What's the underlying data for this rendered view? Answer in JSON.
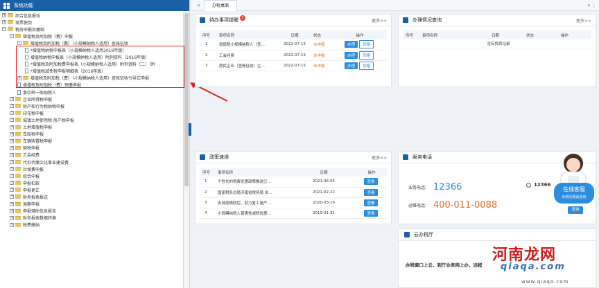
{
  "sidebar": {
    "title": "系统功能",
    "items": [
      {
        "t": "综合信息报告",
        "lvl": 0,
        "tog": "+",
        "ic": "fd"
      },
      {
        "t": "发票使用",
        "lvl": 0,
        "tog": "+",
        "ic": "fd"
      },
      {
        "t": "税务申报及缴纳",
        "lvl": 0,
        "tog": "-",
        "ic": "fd"
      },
      {
        "t": "增值税及附加税（费）申报",
        "lvl": 1,
        "tog": "-",
        "ic": "fd"
      },
      {
        "t": "增值税及附加税（费）（小规模纳税人适用）查账征收",
        "lvl": 2,
        "tog": "-",
        "ic": "fd"
      },
      {
        "t": "*增值税纳税申报表（小规模纳税人适用2016年版）",
        "lvl": 3,
        "tog": "",
        "ic": "doc"
      },
      {
        "t": "增值税纳税申报表（小规模纳税人适用）附列资料（2016年版）",
        "lvl": 3,
        "tog": "",
        "ic": "doc"
      },
      {
        "t": "*增值税及附加税费申报表（小规模纳税人适用）附列资料（二）（附",
        "lvl": 3,
        "tog": "",
        "ic": "doc"
      },
      {
        "t": "*增值税减免税申报明细表（2016年版）",
        "lvl": 3,
        "tog": "",
        "ic": "doc"
      },
      {
        "t": "增值税及附加税（费）（小规模纳税人适用）查账征收引导式申报",
        "lvl": 2,
        "tog": "+",
        "ic": "fd"
      },
      {
        "t": "增值税及附加税（费）预缴申报",
        "lvl": 2,
        "tog": "",
        "ic": "doc"
      },
      {
        "t": "事中转一般纳税人",
        "lvl": 2,
        "tog": "",
        "ic": "doc"
      },
      {
        "t": "企业所得税申报",
        "lvl": 1,
        "tog": "+",
        "ic": "fd"
      },
      {
        "t": "财产和行为税纳税申报",
        "lvl": 1,
        "tog": "+",
        "ic": "fd"
      },
      {
        "t": "印花税申报",
        "lvl": 1,
        "tog": "+",
        "ic": "fd"
      },
      {
        "t": "城镇土地使用税 房产税申报",
        "lvl": 1,
        "tog": "+",
        "ic": "fd"
      },
      {
        "t": "土地增值税申报",
        "lvl": 1,
        "tog": "+",
        "ic": "fd"
      },
      {
        "t": "车船税申报",
        "lvl": 1,
        "tog": "+",
        "ic": "fd"
      },
      {
        "t": "车辆购置税申报",
        "lvl": 1,
        "tog": "+",
        "ic": "fd"
      },
      {
        "t": "契税申报",
        "lvl": 1,
        "tog": "+",
        "ic": "fd"
      },
      {
        "t": "工会经费",
        "lvl": 1,
        "tog": "+",
        "ic": "fd"
      },
      {
        "t": "代扣代缴文化事业建设费",
        "lvl": 1,
        "tog": "+",
        "ic": "fd"
      },
      {
        "t": "社保费申报",
        "lvl": 1,
        "tog": "+",
        "ic": "fd"
      },
      {
        "t": "综合申报",
        "lvl": 1,
        "tog": "+",
        "ic": "fd"
      },
      {
        "t": "申报扣款",
        "lvl": 1,
        "tog": "+",
        "ic": "fd"
      },
      {
        "t": "申报更正",
        "lvl": 1,
        "tog": "+",
        "ic": "fd"
      },
      {
        "t": "财务报表报送",
        "lvl": 1,
        "tog": "+",
        "ic": "fd"
      },
      {
        "t": "逾期申报",
        "lvl": 1,
        "tog": "+",
        "ic": "fd"
      },
      {
        "t": "申报辅助信息报告",
        "lvl": 1,
        "tog": "+",
        "ic": "fd"
      },
      {
        "t": "财务报表数据转换",
        "lvl": 1,
        "tog": "+",
        "ic": "fd"
      },
      {
        "t": "税费缴纳",
        "lvl": 1,
        "tog": "+",
        "ic": "fd"
      }
    ]
  },
  "tabs": {
    "prev": "«",
    "current": "办税桌面",
    "next": "»",
    "menu": "⋮"
  },
  "todo": {
    "title": "待办事项提醒",
    "badge": "3",
    "more": "更多>>",
    "headers": [
      "序号",
      "事项名称",
      "日期",
      "状态",
      "操作"
    ],
    "rows": [
      {
        "no": "1",
        "name": "增值税小规模纳税人（查…",
        "date": "2022-07-15",
        "status": "未申报",
        "a": "办理",
        "b": "忽略"
      },
      {
        "no": "2",
        "name": "工会经费",
        "date": "2022-07-15",
        "status": "未申报",
        "a": "办理",
        "b": "忽略"
      },
      {
        "no": "3",
        "name": "房民企业（查账征收）企…",
        "date": "2022-07-15",
        "status": "未申报",
        "a": "办理",
        "b": "忽略"
      }
    ]
  },
  "handling": {
    "title": "办理情况查询",
    "more": "更多>>",
    "headers": [
      "序号",
      "事项名称",
      "日期",
      "状态",
      "操作"
    ],
    "empty": "没有找到记录"
  },
  "policy": {
    "title": "政策速递",
    "more": "更多>>",
    "headers": [
      "序号",
      "事项名称",
      "日期",
      "操作"
    ],
    "rows": [
      {
        "no": "1",
        "name": "个性化的税费优惠政策推送已…",
        "date": "2021-08-05",
        "a": "查看"
      },
      {
        "no": "2",
        "name": "国家税务总局河南省税务局 关…",
        "date": "2021-02-22",
        "a": "查看"
      },
      {
        "no": "3",
        "name": "支持疫情防控、助力复工复产…",
        "date": "2020-03-16",
        "a": "查看"
      },
      {
        "no": "4",
        "name": "小规模纳税人普惠性减税优惠…",
        "date": "2019-01-31",
        "a": "查看"
      }
    ]
  },
  "service": {
    "title": "服务电话",
    "l1": "业务电话：",
    "p1": "12366",
    "l2": "运维电话：",
    "p2": "400-011-0088",
    "p3": "12366"
  },
  "online": {
    "title": "在线客服",
    "sub": "办税问题请咨询",
    "btn": "咨询"
  },
  "hall": {
    "title": "云办税厅",
    "text": "办税窗口上云，到厅业务网上办，远程"
  },
  "watermark": {
    "cn": "河南龙网",
    "latin": "qiaqa.com",
    "url": "www.qiaqa.com"
  }
}
